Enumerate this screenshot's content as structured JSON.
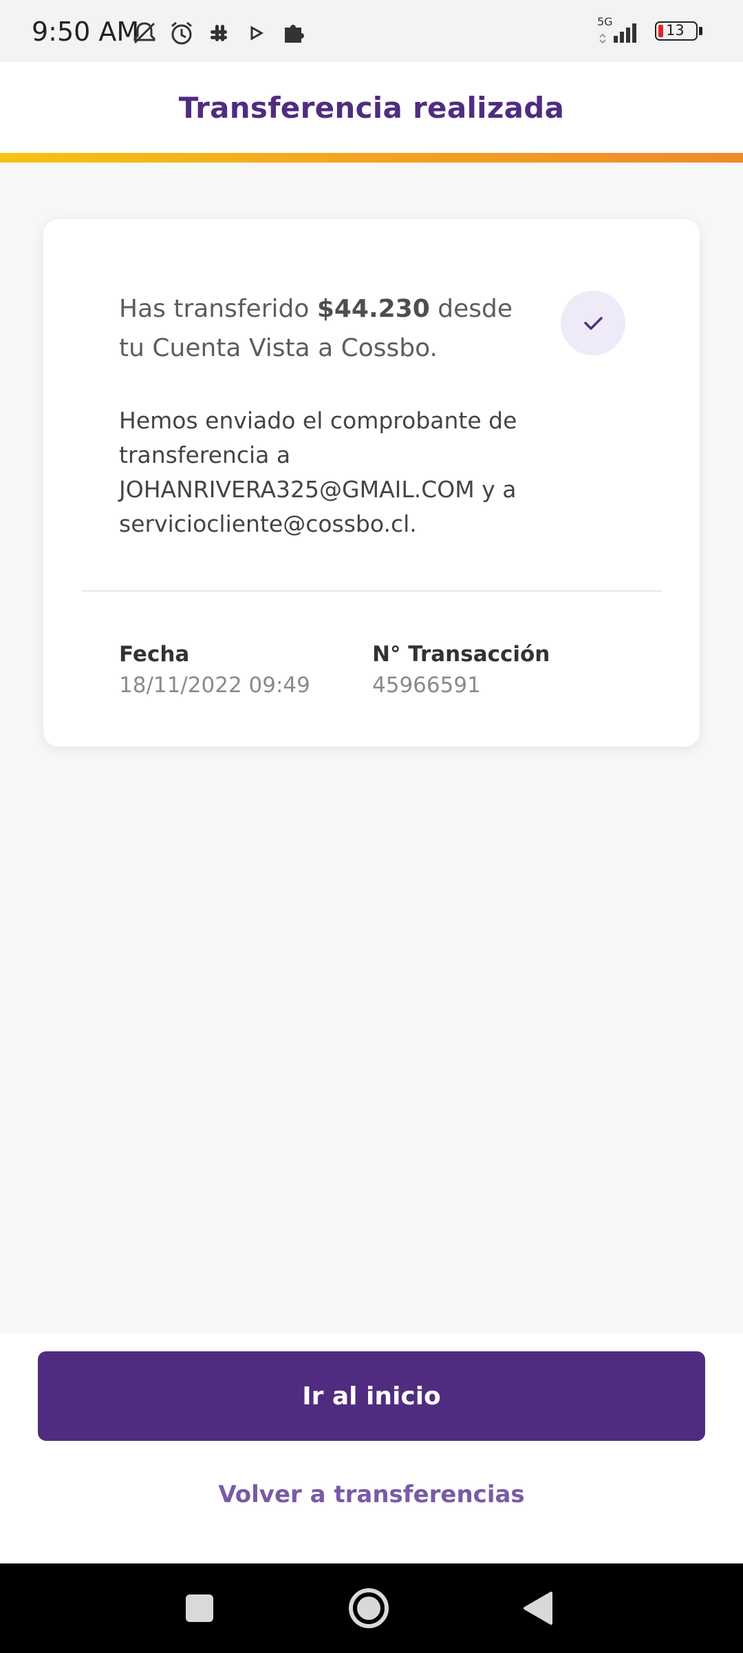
{
  "status_bar": {
    "time": "9:50 AM",
    "network": "5G",
    "battery": "13",
    "left_icons": [
      "bell-off-icon",
      "alarm-icon",
      "slack-icon",
      "play-icon",
      "puzzle-icon"
    ],
    "right_icons": [
      "signal-icon",
      "battery-icon"
    ]
  },
  "header": {
    "title": "Transferencia realizada"
  },
  "colors": {
    "brand_purple": "#4f2c7f",
    "accent_yellow": "#f6c313",
    "accent_orange": "#ef8a2b",
    "link_purple": "#7a5aa6"
  },
  "receipt": {
    "summary_prefix": "Has transferido ",
    "amount": "$44.230",
    "summary_suffix": " desde tu Cuenta Vista a Cossbo.",
    "notice": "Hemos enviado el comprobante de transferencia a JOHANRIVERA325@GMAIL.COM y a serviciocliente@cossbo.cl.",
    "date_label": "Fecha",
    "date_value": "18/11/2022 09:49",
    "transaction_label": "N° Transacción",
    "transaction_value": "45966591",
    "status_icon": "check-icon"
  },
  "actions": {
    "primary_label": "Ir al inicio",
    "secondary_label": "Volver a transferencias"
  },
  "nav": {
    "icons": [
      "recents-square-icon",
      "home-circle-icon",
      "back-triangle-icon"
    ]
  }
}
